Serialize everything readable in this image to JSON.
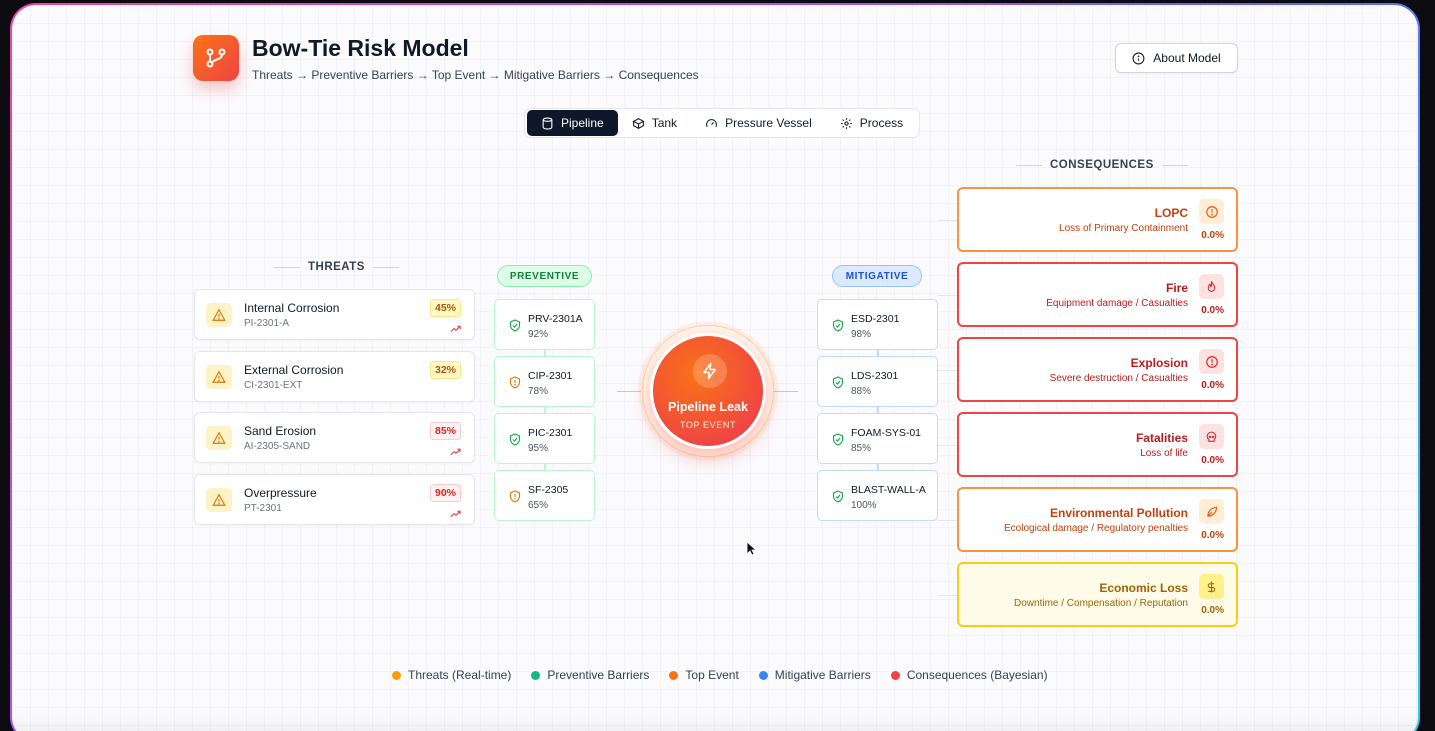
{
  "header": {
    "title": "Bow-Tie Risk Model",
    "subtitle": "Threats → Preventive Barriers → Top Event → Mitigative Barriers → Consequences",
    "about_label": "About Model"
  },
  "tabs": [
    {
      "label": "Pipeline",
      "icon": "cylinder-icon",
      "active": true
    },
    {
      "label": "Tank",
      "icon": "box-icon",
      "active": false
    },
    {
      "label": "Pressure Vessel",
      "icon": "gauge-icon",
      "active": false
    },
    {
      "label": "Process",
      "icon": "gear-icon",
      "active": false
    }
  ],
  "sections": {
    "threats": "THREATS",
    "consequences": "CONSEQUENCES",
    "preventive": "PREVENTIVE",
    "mitigative": "MITIGATIVE"
  },
  "threats": [
    {
      "name": "Internal Corrosion",
      "code": "PI-2301-A",
      "pct": "45%",
      "level": "amber",
      "trending": true
    },
    {
      "name": "External Corrosion",
      "code": "CI-2301-EXT",
      "pct": "32%",
      "level": "amber",
      "trending": false
    },
    {
      "name": "Sand Erosion",
      "code": "AI-2305-SAND",
      "pct": "85%",
      "level": "red",
      "trending": true
    },
    {
      "name": "Overpressure",
      "code": "PT-2301",
      "pct": "90%",
      "level": "red",
      "trending": true
    }
  ],
  "preventive_barriers": [
    {
      "name": "PRV-2301A",
      "value": "92%",
      "status": "ok"
    },
    {
      "name": "CIP-2301",
      "value": "78%",
      "status": "warn"
    },
    {
      "name": "PIC-2301",
      "value": "95%",
      "status": "ok"
    },
    {
      "name": "SF-2305",
      "value": "65%",
      "status": "warn"
    }
  ],
  "top_event": {
    "name": "Pipeline Leak",
    "label": "TOP EVENT"
  },
  "mitigative_barriers": [
    {
      "name": "ESD-2301",
      "value": "98%"
    },
    {
      "name": "LDS-2301",
      "value": "88%"
    },
    {
      "name": "FOAM-SYS-01",
      "value": "85%"
    },
    {
      "name": "BLAST-WALL-A",
      "value": "100%"
    }
  ],
  "consequences": [
    {
      "name": "LOPC",
      "desc": "Loss of Primary Containment",
      "value": "0.0%",
      "tone": "orange",
      "icon": "alert-circle-icon"
    },
    {
      "name": "Fire",
      "desc": "Equipment damage / Casualties",
      "value": "0.0%",
      "tone": "red",
      "icon": "flame-icon"
    },
    {
      "name": "Explosion",
      "desc": "Severe destruction / Casualties",
      "value": "0.0%",
      "tone": "red",
      "icon": "alert-circle-icon"
    },
    {
      "name": "Fatalities",
      "desc": "Loss of life",
      "value": "0.0%",
      "tone": "red",
      "icon": "skull-icon"
    },
    {
      "name": "Environmental Pollution",
      "desc": "Ecological damage / Regulatory penalties",
      "value": "0.0%",
      "tone": "orange",
      "icon": "leaf-icon"
    },
    {
      "name": "Economic Loss",
      "desc": "Downtime / Compensation / Reputation",
      "value": "0.0%",
      "tone": "yellow",
      "icon": "dollar-icon"
    }
  ],
  "legend": [
    {
      "label": "Threats (Real-time)",
      "color": "#f59e0b"
    },
    {
      "label": "Preventive Barriers",
      "color": "#10b981"
    },
    {
      "label": "Top Event",
      "color": "#f97316"
    },
    {
      "label": "Mitigative Barriers",
      "color": "#3b82f6"
    },
    {
      "label": "Consequences (Bayesian)",
      "color": "#ef4444"
    }
  ],
  "colors": {
    "accent": "#0f172a",
    "threat_amber": "#f59e0b",
    "preventive": "#16a34a",
    "mitigative": "#3b82f6",
    "top_event": "#f97316",
    "consequence": "#ef4444"
  }
}
